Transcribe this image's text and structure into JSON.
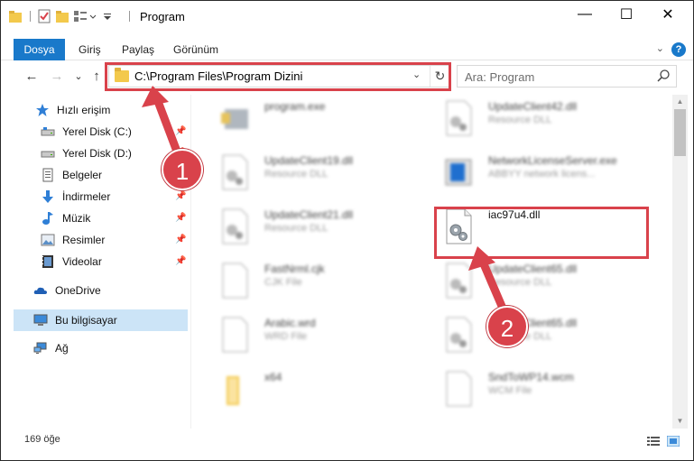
{
  "window": {
    "title": "Program",
    "controls": {
      "minimize": "—",
      "maximize": "☐",
      "close": "✕"
    }
  },
  "ribbon": {
    "tabs": [
      "Dosya",
      "Giriş",
      "Paylaş",
      "Görünüm"
    ],
    "help": "?",
    "expand": "⌄"
  },
  "nav": {
    "back": "←",
    "forward": "→",
    "recent": "⌄",
    "up": "↑",
    "address": "C:\\Program Files\\Program Dizini",
    "address_dropdown": "⌄",
    "refresh": "↻",
    "search_placeholder": "Ara: Program"
  },
  "sidebar": {
    "items": [
      {
        "label": "Hızlı erişim",
        "icon": "star-icon",
        "pinned": false
      },
      {
        "label": "Yerel Disk (C:)",
        "icon": "drive-icon",
        "pinned": true
      },
      {
        "label": "Yerel Disk (D:)",
        "icon": "drive-icon",
        "pinned": true
      },
      {
        "label": "Belgeler",
        "icon": "documents-icon",
        "pinned": true
      },
      {
        "label": "İndirmeler",
        "icon": "downloads-icon",
        "pinned": true
      },
      {
        "label": "Müzik",
        "icon": "music-icon",
        "pinned": true
      },
      {
        "label": "Resimler",
        "icon": "pictures-icon",
        "pinned": true
      },
      {
        "label": "Videolar",
        "icon": "videos-icon",
        "pinned": true
      },
      {
        "label": "OneDrive",
        "icon": "cloud-icon",
        "pinned": false
      },
      {
        "label": "Bu bilgisayar",
        "icon": "computer-icon",
        "pinned": false,
        "selected": true
      },
      {
        "label": "Ağ",
        "icon": "network-icon",
        "pinned": false
      }
    ]
  },
  "files": {
    "left": [
      {
        "name": "program.exe",
        "desc": "",
        "icon": "exe-icon"
      },
      {
        "name": "UpdateClient19.dll",
        "desc": "Resource DLL",
        "icon": "dll-icon"
      },
      {
        "name": "UpdateClient21.dll",
        "desc": "Resource DLL",
        "icon": "dll-icon"
      },
      {
        "name": "FastNrml.cjk",
        "desc": "CJK File",
        "icon": "file-icon"
      },
      {
        "name": "Arabic.wrd",
        "desc": "WRD File",
        "icon": "file-icon"
      },
      {
        "name": "x64",
        "desc": "",
        "icon": "folder-icon"
      }
    ],
    "right": [
      {
        "name": "UpdateClient42.dll",
        "desc": "Resource DLL",
        "icon": "dll-icon"
      },
      {
        "name": "NetworkLicenseServer.exe",
        "desc": "ABBYY network licens...",
        "icon": "exe-icon"
      },
      {
        "name": "iac97u4.dll",
        "desc": "",
        "icon": "dll-icon",
        "highlighted": true
      },
      {
        "name": "UpdateClient65.dll",
        "desc": "Resource DLL",
        "icon": "dll-icon"
      },
      {
        "name": "UpdateClient65.dll",
        "desc": "Resource DLL",
        "icon": "dll-icon"
      },
      {
        "name": "SndToWP14.wcm",
        "desc": "WCM File",
        "icon": "file-icon"
      }
    ]
  },
  "status": {
    "count": "169 öğe"
  },
  "callouts": [
    "1",
    "2"
  ],
  "colors": {
    "accent": "#1979ca",
    "highlight": "#d9424b",
    "selected": "#cce4f7"
  }
}
